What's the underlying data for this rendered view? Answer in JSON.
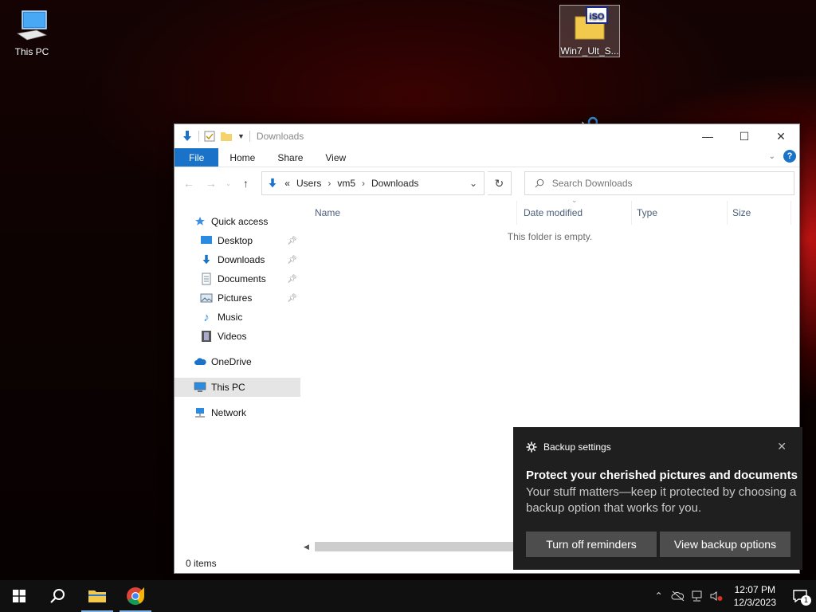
{
  "desktop": {
    "icons": [
      {
        "label": "This PC",
        "icon": "computer-icon"
      },
      {
        "label": "Win7_Ult_S...",
        "icon": "iso-file-icon",
        "badge": "iSO"
      }
    ]
  },
  "explorer": {
    "title": "Downloads",
    "ribbon_tabs": [
      "File",
      "Home",
      "Share",
      "View"
    ],
    "help_label": "?",
    "breadcrumb": [
      "Users",
      "vm5",
      "Downloads"
    ],
    "breadcrumb_prefix": "«",
    "search_placeholder": "Search Downloads",
    "sidebar": {
      "quick_access": "Quick access",
      "items": [
        {
          "label": "Desktop",
          "icon": "desktop-icon",
          "pinned": true
        },
        {
          "label": "Downloads",
          "icon": "downloads-icon",
          "pinned": true
        },
        {
          "label": "Documents",
          "icon": "documents-icon",
          "pinned": true
        },
        {
          "label": "Pictures",
          "icon": "pictures-icon",
          "pinned": true
        },
        {
          "label": "Music",
          "icon": "music-icon",
          "pinned": false
        },
        {
          "label": "Videos",
          "icon": "videos-icon",
          "pinned": false
        }
      ],
      "onedrive": "OneDrive",
      "this_pc": "This PC",
      "network": "Network"
    },
    "columns": [
      "Name",
      "Date modified",
      "Type",
      "Size"
    ],
    "empty_message": "This folder is empty.",
    "status": "0 items"
  },
  "toast": {
    "app": "Backup settings",
    "title": "Protect your cherished pictures and documents",
    "body": "Your stuff matters—keep it protected by choosing a backup option that works for you.",
    "buttons": [
      "Turn off reminders",
      "View backup options"
    ]
  },
  "taskbar": {
    "time": "12:07 PM",
    "date": "12/3/2023",
    "notification_count": "1"
  },
  "colors": {
    "accent": "#1a73c8",
    "toast_bg": "#1f1f1f",
    "taskbar_bg": "#101010"
  }
}
